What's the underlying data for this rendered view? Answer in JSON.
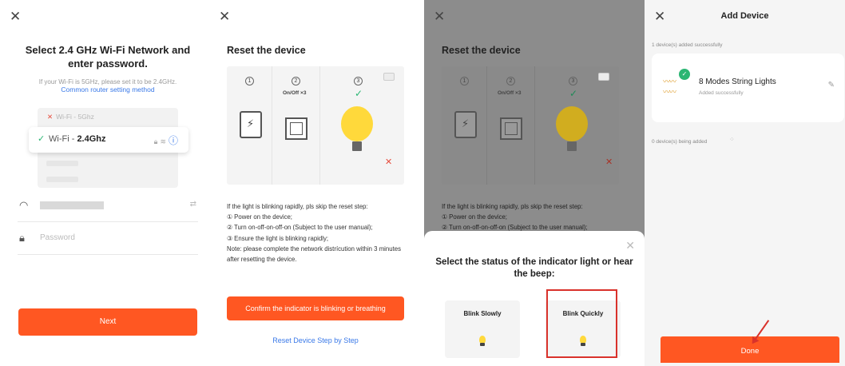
{
  "panel1": {
    "title": "Select 2.4 GHz Wi-Fi Network and enter password.",
    "subtitle": "If your Wi-Fi is 5GHz, please set it to be 2.4GHz.",
    "router_link": "Common router setting method",
    "wifi_5g": "Wi-Fi - 5Ghz",
    "wifi_24_prefix": "Wi-Fi - ",
    "wifi_24_band": "2.4Ghz",
    "password_placeholder": "Password",
    "next_label": "Next"
  },
  "panel2": {
    "title": "Reset the device",
    "step_onoff": "On/Off ×3",
    "instructions": [
      "If the light is blinking rapidly, pls skip the reset step:",
      "① Power on the device;",
      "② Turn on-off-on-off-on (Subject to the user manual);",
      "③ Ensure the light is blinking rapidly;",
      "Note: please complete the network distrícution within 3 minutes after resetting the device."
    ],
    "confirm_label": "Confirm the indicator is blinking or breathing",
    "reset_link": "Reset Device Step by Step"
  },
  "panel3": {
    "title": "Reset the device",
    "step_onoff": "On/Off ×3",
    "instructions": [
      "If the light is blinking rapidly, pls skip the reset step:",
      "① Power on the device;",
      "② Turn on-off-on-off-on (Subject to the user manual);"
    ],
    "sheet_question": "Select the status of the indicator light or hear the beep:",
    "option_slow": "Blink Slowly",
    "option_quick": "Blink Quickly"
  },
  "panel4": {
    "title": "Add Device",
    "added_label": "1 device(s) added successfully",
    "device_name": "8 Modes String Lights",
    "device_status": "Added successfully",
    "adding_label": "0 device(s) being added",
    "done_label": "Done"
  },
  "colors": {
    "accent": "#ff5722",
    "link": "#3a79e8",
    "success": "#2bb673",
    "error": "#e64b3c"
  }
}
